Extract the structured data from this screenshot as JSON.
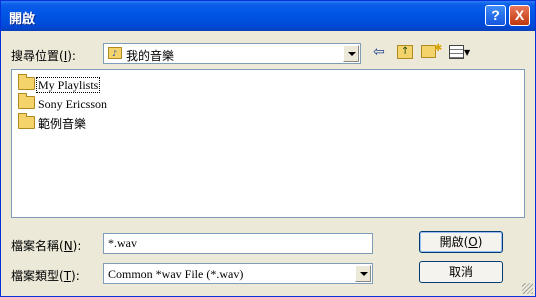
{
  "window": {
    "title": "開啟",
    "help_glyph": "?",
    "close_glyph": "X"
  },
  "look_in": {
    "label_pre": "搜尋位置(",
    "label_key": "I",
    "label_post": "):",
    "value": "我的音樂"
  },
  "toolbar": {
    "back_icon": "back-arrow-icon",
    "up_icon": "up-folder-icon",
    "new_folder_icon": "new-folder-icon",
    "view_icon": "view-menu-icon"
  },
  "files": [
    {
      "name": "My Playlists",
      "icon": "folder-icon",
      "selected": true
    },
    {
      "name": "Sony Ericsson",
      "icon": "folder-icon",
      "selected": false
    },
    {
      "name": "範例音樂",
      "icon": "music-folder-icon",
      "selected": false
    }
  ],
  "filename": {
    "label_pre": "檔案名稱(",
    "label_key": "N",
    "label_post": "):",
    "value": "*.wav"
  },
  "filetype": {
    "label_pre": "檔案類型(",
    "label_key": "T",
    "label_post": "):",
    "value": "Common *wav File (*.wav)"
  },
  "buttons": {
    "open_pre": "開啟(",
    "open_key": "O",
    "open_post": ")",
    "cancel": "取消"
  },
  "colors": {
    "titlebar": "#0055e5",
    "dialog_bg": "#ece9d8",
    "border": "#7f9db9"
  }
}
